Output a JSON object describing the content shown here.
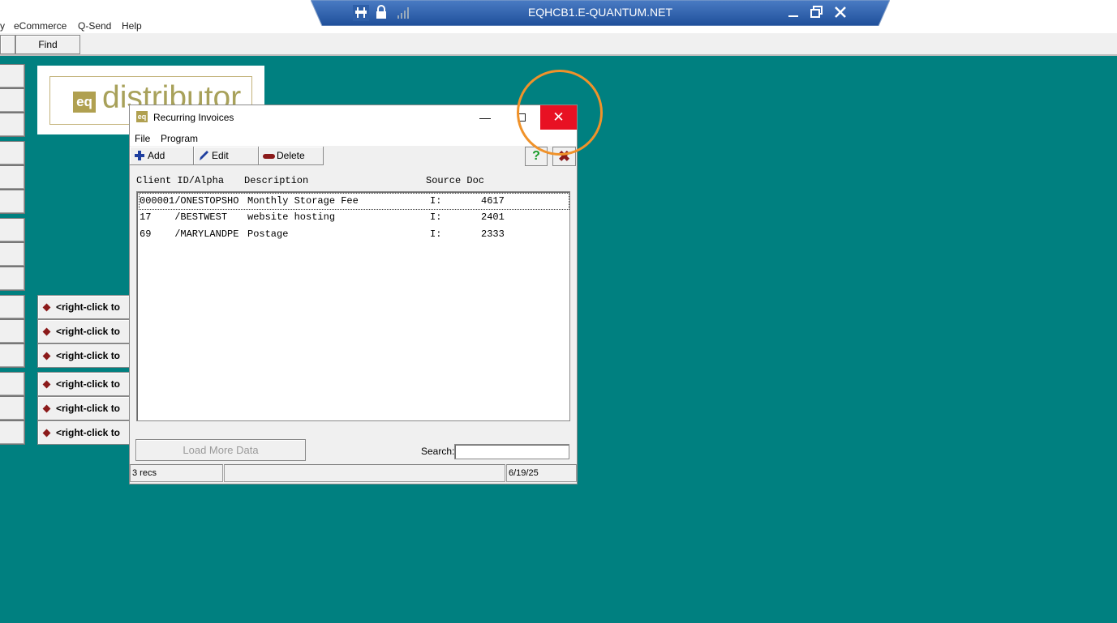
{
  "app_menu": {
    "items": [
      "y",
      "eCommerce",
      "Q-Send",
      "Help"
    ]
  },
  "app_toolbar": {
    "find_label": "Find"
  },
  "remote_session": {
    "title": "EQHCB1.E-QUANTUM.NET",
    "icons": [
      "pin-icon",
      "lock-icon",
      "signal-icon",
      "minimize-icon",
      "restore-icon",
      "close-icon"
    ]
  },
  "logo": {
    "badge": "eq",
    "text": "distributor"
  },
  "quick_buttons": [
    {
      "label": "<right-click to"
    },
    {
      "label": "<right-click to"
    },
    {
      "label": "<right-click to"
    },
    {
      "label": "<right-click to"
    },
    {
      "label": "<right-click to"
    },
    {
      "label": "<right-click to"
    }
  ],
  "dialog": {
    "icon_text": "eq",
    "title": "Recurring Invoices",
    "close_glyph": "✕",
    "minimize_glyph": "—",
    "menu": [
      "File",
      "Program"
    ],
    "toolbar": {
      "add_label": "Add",
      "edit_label": "Edit",
      "delete_label": "Delete",
      "help_glyph": "?",
      "exit_glyph": "✖"
    },
    "columns": {
      "client": "Client ID/Alpha",
      "description": "Description",
      "source_doc": "Source Doc"
    },
    "rows": [
      {
        "client": "000001/ONESTOPSHO",
        "description": "Monthly Storage Fee",
        "source": "I:",
        "doc": "4617"
      },
      {
        "client": "17    /BESTWEST",
        "description": "website hosting",
        "source": "I:",
        "doc": "2401"
      },
      {
        "client": "69    /MARYLANDPE",
        "description": "Postage",
        "source": "I:",
        "doc": "2333"
      }
    ],
    "load_more_label": "Load More Data",
    "search_label": "Search:",
    "search_value": "",
    "status": {
      "records": "3 recs",
      "middle": "",
      "date": "6/19/25"
    }
  },
  "colors": {
    "desktop": "#008080",
    "close_red": "#e81123",
    "highlight": "#f0922a",
    "brand": "#b0a050"
  }
}
